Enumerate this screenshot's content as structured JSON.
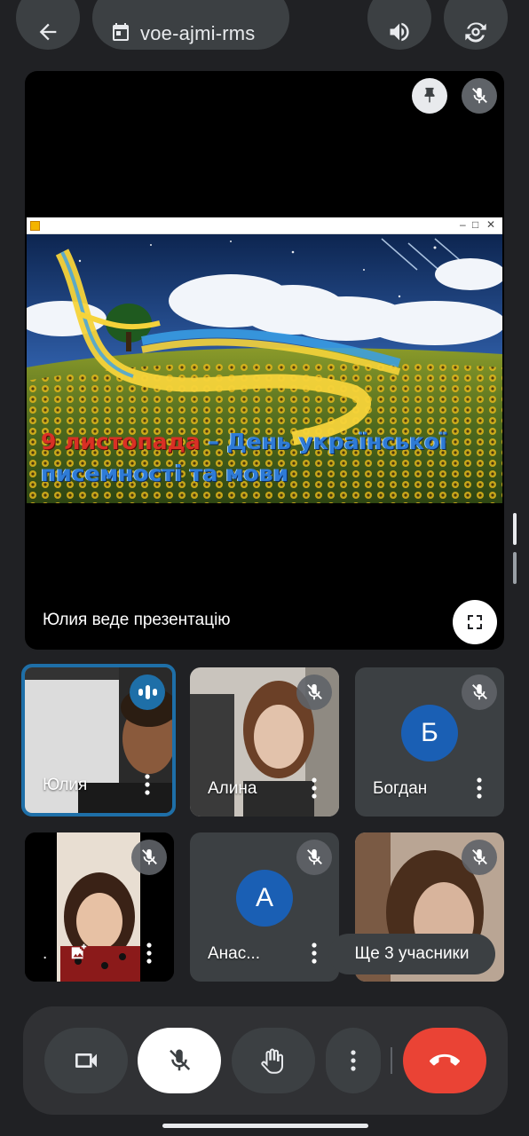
{
  "header": {
    "meeting_code": "voe-ajmi-rms",
    "icons": [
      "back-arrow-icon",
      "calendar-icon",
      "volume-icon",
      "switch-camera-icon"
    ]
  },
  "presentation": {
    "slide_title_line1_red": "9 листопада",
    "slide_title_line1_rest": " – День української",
    "slide_title_line2": "писемності та мови",
    "window_controls": [
      "–",
      "□",
      "✕"
    ],
    "label": "Юлия веде презентацію"
  },
  "participants": [
    {
      "name": "Юлия",
      "speaking": true
    },
    {
      "name": "Алина",
      "muted": true
    },
    {
      "name": "Богдан",
      "initial": "Б",
      "muted": true
    },
    {
      "name": ".",
      "muted": true
    },
    {
      "name": "Анас...",
      "initial": "А",
      "muted": true
    },
    {
      "name": "",
      "muted": true
    }
  ],
  "more_participants_label": "Ще 3 учасники",
  "controls": {
    "icons": [
      "video-camera-icon",
      "mic-off-icon",
      "raise-hand-icon",
      "more-vert-icon",
      "end-call-icon"
    ]
  },
  "colors": {
    "background": "#202124",
    "tile": "#3c4043",
    "accent": "#1e6fa8",
    "end_call": "#ea4335"
  }
}
